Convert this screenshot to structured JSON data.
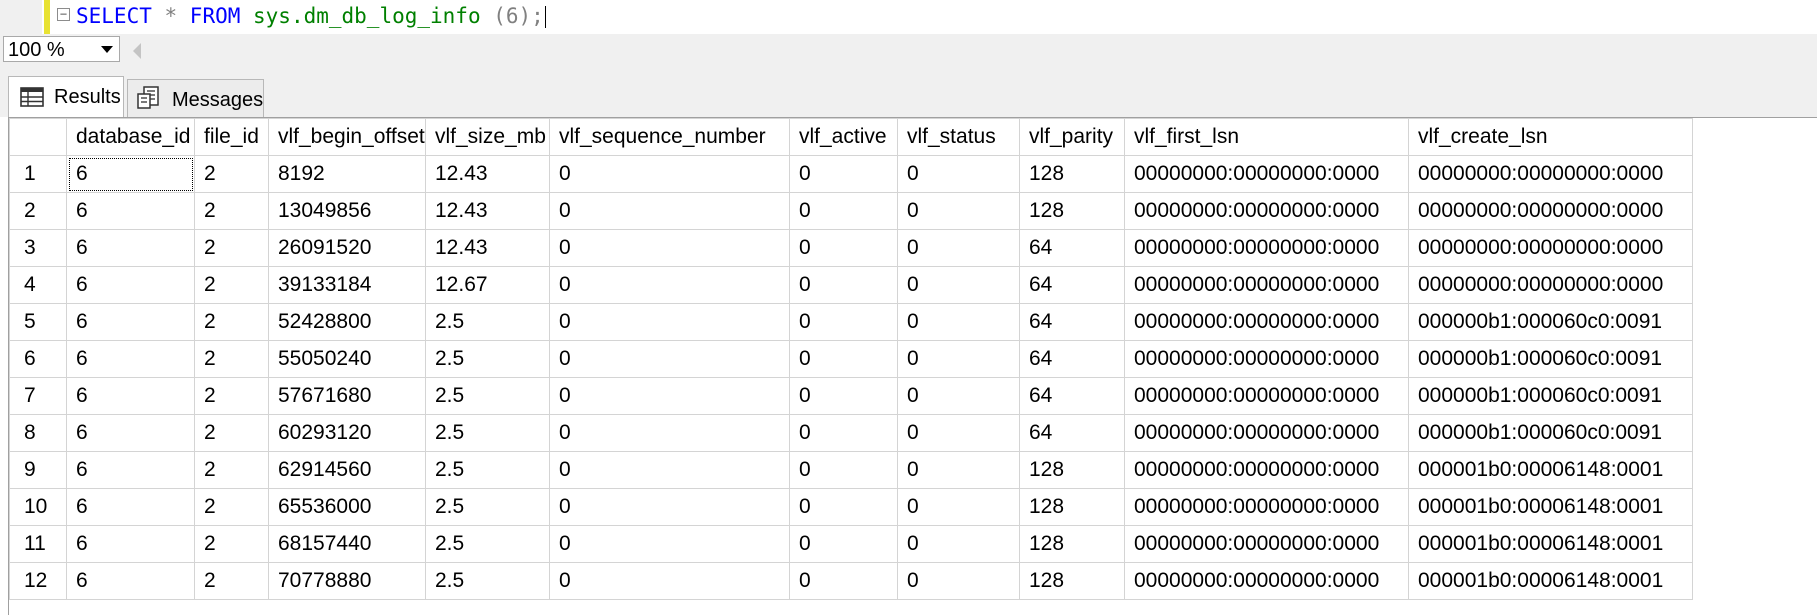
{
  "editor": {
    "query_select": "SELECT",
    "query_star": " * ",
    "query_from": "FROM",
    "query_object": " sys.dm_db_log_info ",
    "query_args": "(6);",
    "fold_glyph": "−"
  },
  "zoom": {
    "value": "100 %"
  },
  "tabs": [
    {
      "label": "Results",
      "icon": "grid-icon",
      "active": true
    },
    {
      "label": "Messages",
      "icon": "messages-icon",
      "active": false
    }
  ],
  "grid": {
    "columns": [
      "",
      "database_id",
      "file_id",
      "vlf_begin_offset",
      "vlf_size_mb",
      "vlf_sequence_number",
      "vlf_active",
      "vlf_status",
      "vlf_parity",
      "vlf_first_lsn",
      "vlf_create_lsn"
    ],
    "rows": [
      [
        "1",
        "6",
        "2",
        "8192",
        "12.43",
        "0",
        "0",
        "0",
        "128",
        "00000000:00000000:0000",
        "00000000:00000000:0000"
      ],
      [
        "2",
        "6",
        "2",
        "13049856",
        "12.43",
        "0",
        "0",
        "0",
        "128",
        "00000000:00000000:0000",
        "00000000:00000000:0000"
      ],
      [
        "3",
        "6",
        "2",
        "26091520",
        "12.43",
        "0",
        "0",
        "0",
        "64",
        "00000000:00000000:0000",
        "00000000:00000000:0000"
      ],
      [
        "4",
        "6",
        "2",
        "39133184",
        "12.67",
        "0",
        "0",
        "0",
        "64",
        "00000000:00000000:0000",
        "00000000:00000000:0000"
      ],
      [
        "5",
        "6",
        "2",
        "52428800",
        "2.5",
        "0",
        "0",
        "0",
        "64",
        "00000000:00000000:0000",
        "000000b1:000060c0:0091"
      ],
      [
        "6",
        "6",
        "2",
        "55050240",
        "2.5",
        "0",
        "0",
        "0",
        "64",
        "00000000:00000000:0000",
        "000000b1:000060c0:0091"
      ],
      [
        "7",
        "6",
        "2",
        "57671680",
        "2.5",
        "0",
        "0",
        "0",
        "64",
        "00000000:00000000:0000",
        "000000b1:000060c0:0091"
      ],
      [
        "8",
        "6",
        "2",
        "60293120",
        "2.5",
        "0",
        "0",
        "0",
        "64",
        "00000000:00000000:0000",
        "000000b1:000060c0:0091"
      ],
      [
        "9",
        "6",
        "2",
        "62914560",
        "2.5",
        "0",
        "0",
        "0",
        "128",
        "00000000:00000000:0000",
        "000001b0:00006148:0001"
      ],
      [
        "10",
        "6",
        "2",
        "65536000",
        "2.5",
        "0",
        "0",
        "0",
        "128",
        "00000000:00000000:0000",
        "000001b0:00006148:0001"
      ],
      [
        "11",
        "6",
        "2",
        "68157440",
        "2.5",
        "0",
        "0",
        "0",
        "128",
        "00000000:00000000:0000",
        "000001b0:00006148:0001"
      ],
      [
        "12",
        "6",
        "2",
        "70778880",
        "2.5",
        "0",
        "0",
        "0",
        "128",
        "00000000:00000000:0000",
        "000001b0:00006148:0001"
      ]
    ]
  }
}
